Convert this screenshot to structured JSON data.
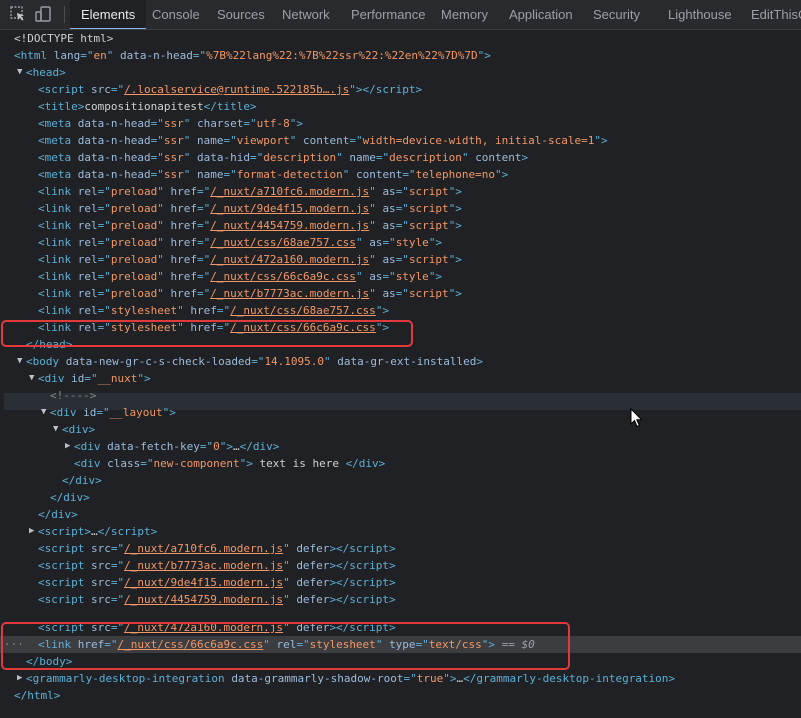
{
  "tabs": [
    {
      "label": "Elements",
      "active": true
    },
    {
      "label": "Console"
    },
    {
      "label": "Sources"
    },
    {
      "label": "Network"
    },
    {
      "label": "Performance"
    },
    {
      "label": "Memory"
    },
    {
      "label": "Application"
    },
    {
      "label": "Security"
    },
    {
      "label": "Lighthouse"
    },
    {
      "label": "EditThisCo"
    }
  ],
  "icons": {
    "inspect": "inspect-element-icon",
    "device": "device-toolbar-icon"
  },
  "colors": {
    "tag": "#5db0d7",
    "attr": "#9bbbdc",
    "value": "#f29766",
    "highlight": "#e03a3a"
  },
  "tree": {
    "doctype": "<!DOCTYPE html>",
    "html_lang": "en",
    "html_nhead": "%7B%22lang%22:%7B%22ssr%22:%22en%22%7D%7D",
    "runtime_src": "/.localservice@runtime.522185b….js",
    "title": "compositionapitest",
    "charset": "utf-8",
    "viewport": "width=device-width, initial-scale=1",
    "format_detection": "telephone=no",
    "preload_links": [
      {
        "href": "/_nuxt/a710fc6.modern.js",
        "as": "script"
      },
      {
        "href": "/_nuxt/9de4f15.modern.js",
        "as": "script"
      },
      {
        "href": "/_nuxt/4454759.modern.js",
        "as": "script"
      },
      {
        "href": "/_nuxt/css/68ae757.css",
        "as": "style"
      },
      {
        "href": "/_nuxt/472a160.modern.js",
        "as": "script"
      },
      {
        "href": "/_nuxt/css/66c6a9c.css",
        "as": "style"
      },
      {
        "href": "/_nuxt/b7773ac.modern.js",
        "as": "script"
      }
    ],
    "stylesheet_1": "/_nuxt/css/68ae757.css",
    "stylesheet_2": "/_nuxt/css/66c6a9c.css",
    "gr_check_loaded": "14.1095.0",
    "nuxt_id": "__nuxt",
    "comment": "<!---->",
    "layout_id": "__layout",
    "fetch_key": "0",
    "component_class": "new-component",
    "component_text": " text is here ",
    "scripts": [
      "/_nuxt/a710fc6.modern.js",
      "/_nuxt/b7773ac.modern.js",
      "/_nuxt/9de4f15.modern.js",
      "/_nuxt/4454759.modern.js",
      "/_nuxt/472a160.modern.js"
    ],
    "selected_link_href": "/_nuxt/css/66c6a9c.css",
    "selected_link_rel": "stylesheet",
    "selected_link_type": "text/css",
    "selected_marker": "== $0",
    "ellipsis": "…",
    "grammarly_shadow_root": "true"
  }
}
